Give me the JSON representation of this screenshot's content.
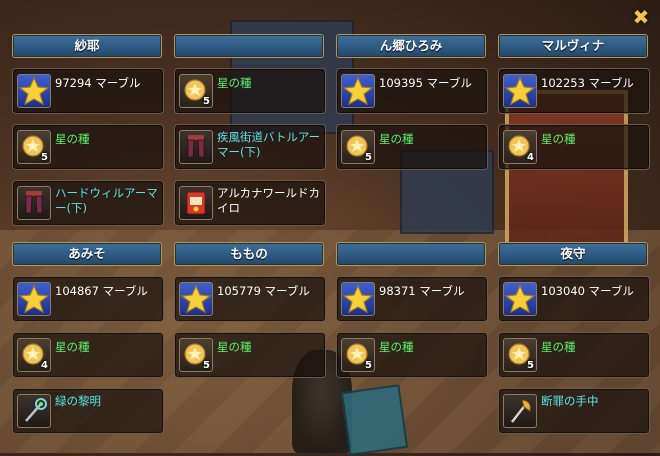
{
  "close_label": "✖",
  "colors": {
    "marble_text": "#ffffff",
    "seed_text": "#5df06a",
    "item_text": "#59e3e8",
    "header_bg": "#2d5b86",
    "header_border": "#b9953f"
  },
  "players": [
    {
      "name": "紗耶",
      "rewards": [
        {
          "icon": "star-icon",
          "text": "97294 マーブル",
          "type": "marble",
          "qty": ""
        },
        {
          "icon": "seed-icon",
          "text": "星の種",
          "type": "seed",
          "qty": "5"
        },
        {
          "icon": "armor-legs-icon",
          "text": "ハードウィルアーマー(下)",
          "type": "item",
          "qty": ""
        }
      ]
    },
    {
      "name": "",
      "rewards": [
        {
          "icon": "seed-icon",
          "text": "星の種",
          "type": "seed",
          "qty": "5"
        },
        {
          "icon": "armor-legs-icon",
          "text": "疾風街道バトルアーマー(下)",
          "type": "item",
          "qty": ""
        },
        {
          "icon": "warmer-pack-icon",
          "text": "アルカナワールドカイロ",
          "type": "item-white",
          "qty": ""
        }
      ]
    },
    {
      "name": "ん郷ひろみ",
      "rewards": [
        {
          "icon": "star-icon",
          "text": "109395 マーブル",
          "type": "marble",
          "qty": ""
        },
        {
          "icon": "seed-icon",
          "text": "星の種",
          "type": "seed",
          "qty": "5"
        }
      ]
    },
    {
      "name": "マルヴィナ",
      "rewards": [
        {
          "icon": "star-icon",
          "text": "102253 マーブル",
          "type": "marble",
          "qty": ""
        },
        {
          "icon": "seed-icon",
          "text": "星の種",
          "type": "seed",
          "qty": "4"
        }
      ]
    },
    {
      "name": "あみそ",
      "rewards": [
        {
          "icon": "star-icon",
          "text": "104867 マーブル",
          "type": "marble",
          "qty": ""
        },
        {
          "icon": "seed-icon",
          "text": "星の種",
          "type": "seed",
          "qty": "4"
        },
        {
          "icon": "staff-icon",
          "text": "緑の黎明",
          "type": "item",
          "qty": ""
        }
      ]
    },
    {
      "name": "ももの",
      "rewards": [
        {
          "icon": "star-icon",
          "text": "105779 マーブル",
          "type": "marble",
          "qty": ""
        },
        {
          "icon": "seed-icon",
          "text": "星の種",
          "type": "seed",
          "qty": "5"
        }
      ]
    },
    {
      "name": "",
      "rewards": [
        {
          "icon": "star-icon",
          "text": "98371 マーブル",
          "type": "marble",
          "qty": ""
        },
        {
          "icon": "seed-icon",
          "text": "星の種",
          "type": "seed",
          "qty": "5"
        }
      ]
    },
    {
      "name": "夜守",
      "rewards": [
        {
          "icon": "star-icon",
          "text": "103040 マーブル",
          "type": "marble",
          "qty": ""
        },
        {
          "icon": "seed-icon",
          "text": "星の種",
          "type": "seed",
          "qty": "5"
        },
        {
          "icon": "axe-icon",
          "text": "断罪の手中",
          "type": "item",
          "qty": ""
        }
      ]
    }
  ]
}
